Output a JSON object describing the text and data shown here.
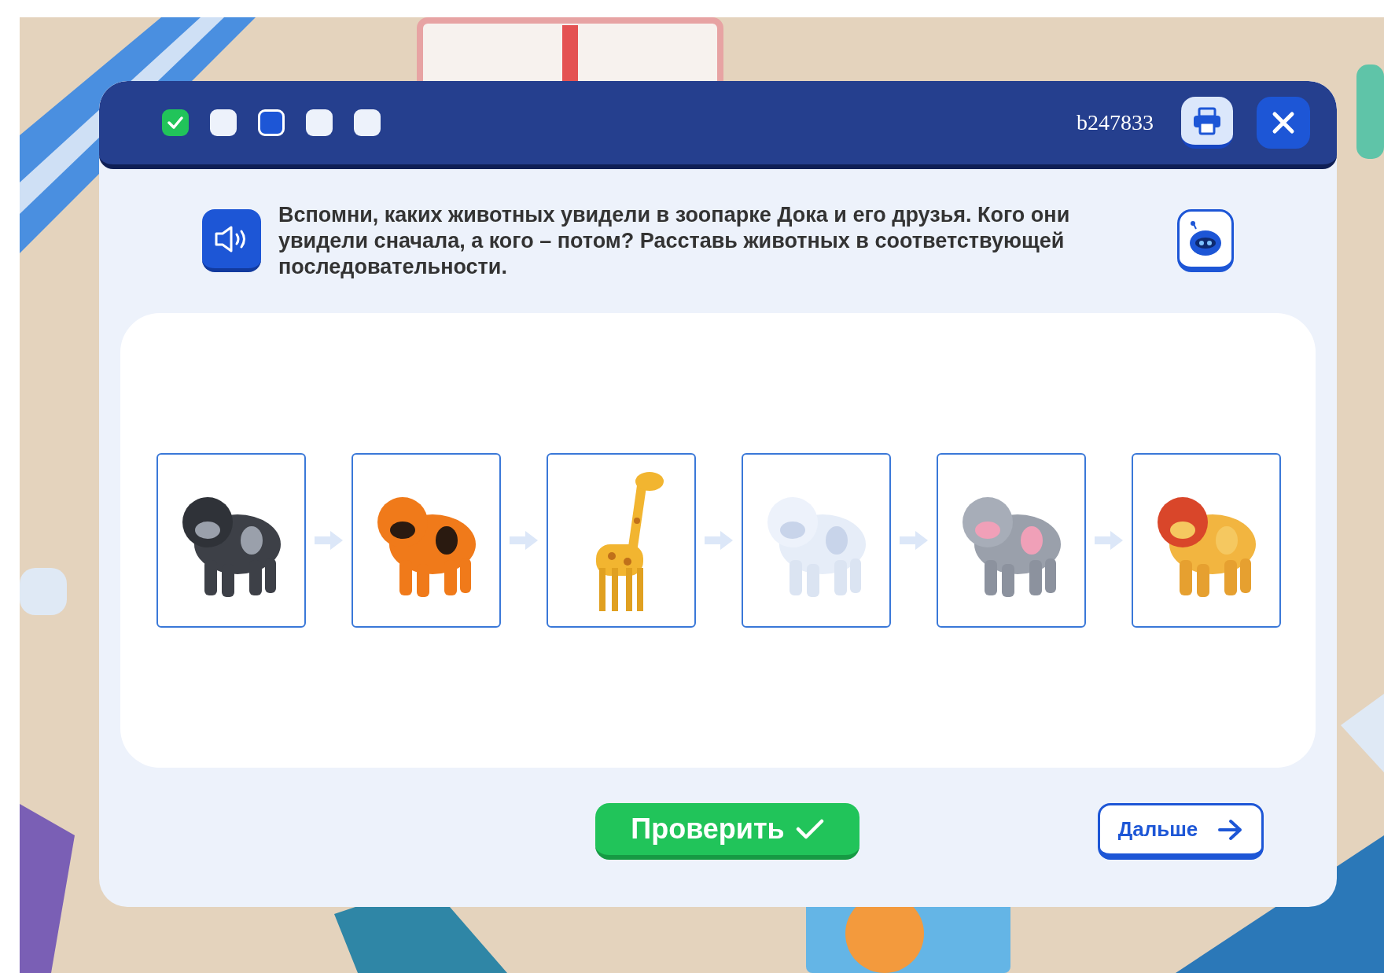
{
  "progress": [
    {
      "checked": true,
      "selected": false
    },
    {
      "checked": false,
      "selected": false
    },
    {
      "checked": false,
      "selected": true
    },
    {
      "checked": false,
      "selected": false
    },
    {
      "checked": false,
      "selected": false
    }
  ],
  "task_code": "b247833",
  "instruction": "Вспомни, каких животных увидели в зоопарке Дока и его друзья. Кого они увидели сначала, а кого – потом? Расставь животных в соответствующей последовательности.",
  "buttons": {
    "check": "Проверить",
    "next": "Дальше"
  }
}
